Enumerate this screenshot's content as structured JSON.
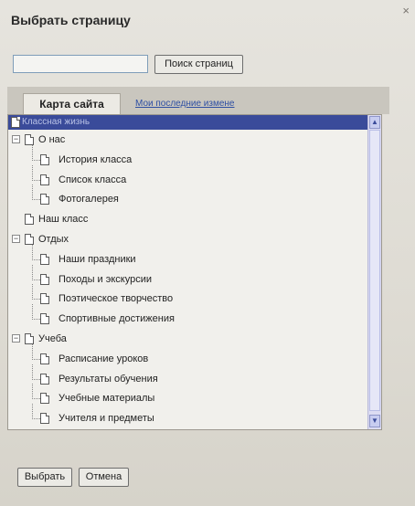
{
  "dialog": {
    "title": "Выбрать страницу",
    "close_glyph": "×"
  },
  "search": {
    "value": "",
    "button_label": "Поиск страниц"
  },
  "tabs": [
    {
      "label": "Карта сайта",
      "active": true
    },
    {
      "label": "Мои последние измене",
      "active": false
    }
  ],
  "tree": {
    "root_label": "Классная жизнь",
    "nodes": [
      {
        "label": "О нас",
        "level": 0,
        "expanded": true
      },
      {
        "label": "История класса",
        "level": 1
      },
      {
        "label": "Список класса",
        "level": 1
      },
      {
        "label": "Фотогалерея",
        "level": 1
      },
      {
        "label": "Наш класс",
        "level": 0
      },
      {
        "label": "Отдых",
        "level": 0,
        "expanded": true
      },
      {
        "label": "Наши праздники",
        "level": 1
      },
      {
        "label": "Походы и экскурсии",
        "level": 1
      },
      {
        "label": "Поэтическое творчество",
        "level": 1
      },
      {
        "label": "Спортивные достижения",
        "level": 1
      },
      {
        "label": "Учеба",
        "level": 0,
        "expanded": true
      },
      {
        "label": "Расписание уроков",
        "level": 1
      },
      {
        "label": "Результаты обучения",
        "level": 1
      },
      {
        "label": "Учебные материалы",
        "level": 1
      },
      {
        "label": "Учителя и предметы",
        "level": 1
      }
    ]
  },
  "footer": {
    "select_label": "Выбрать",
    "cancel_label": "Отмена"
  },
  "colors": {
    "selected_row": "#3a4b9a",
    "link": "#2e4fa3"
  }
}
